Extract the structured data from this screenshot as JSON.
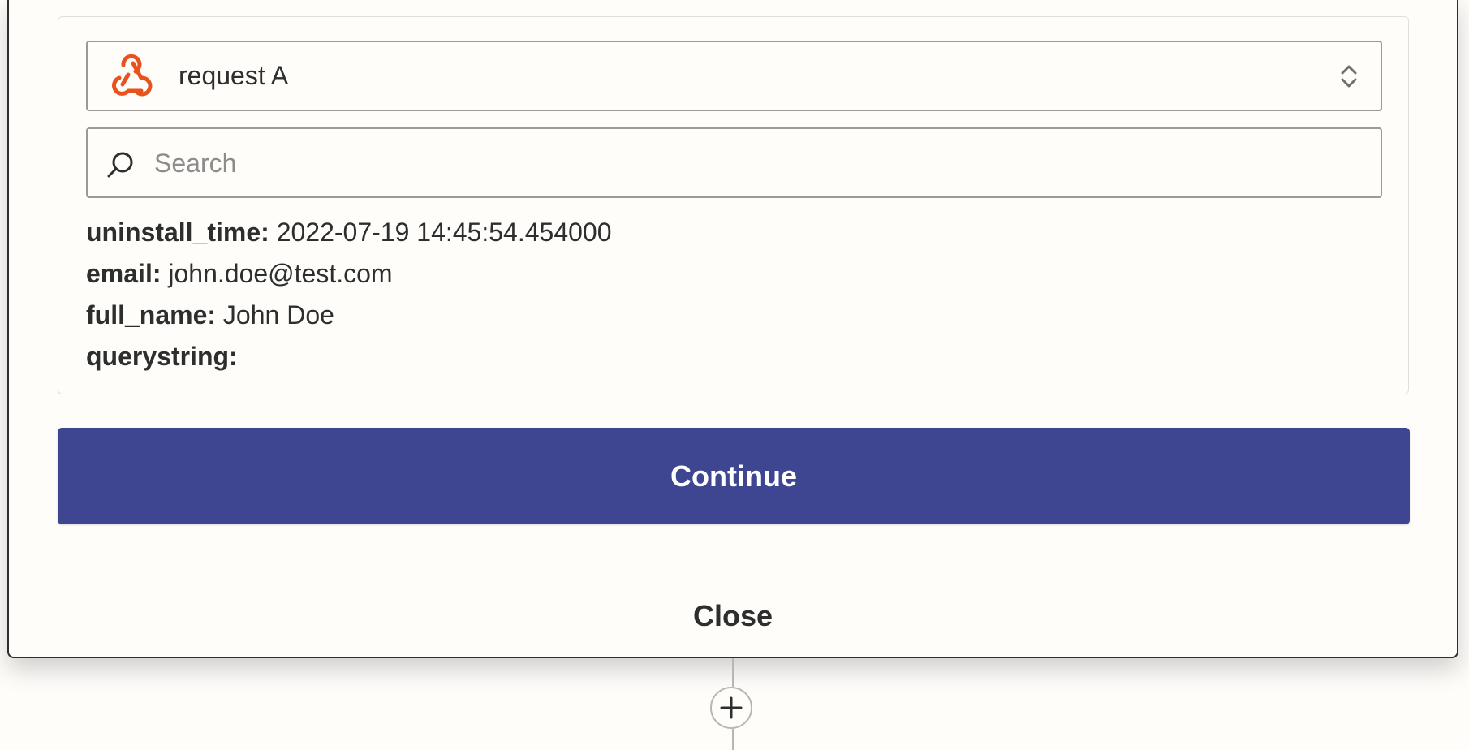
{
  "trigger_select": {
    "selected_label": "request A",
    "icon": "webhook-icon",
    "icon_color": "#e8521f"
  },
  "search": {
    "placeholder": "Search",
    "value": ""
  },
  "sample_fields": [
    {
      "key": "uninstall_time:",
      "value": "2022-07-19 14:45:54.454000"
    },
    {
      "key": "email:",
      "value": "john.doe@test.com"
    },
    {
      "key": "full_name:",
      "value": "John Doe"
    },
    {
      "key": "querystring:",
      "value": ""
    }
  ],
  "actions": {
    "continue_label": "Continue",
    "continue_color": "#3e4692",
    "close_label": "Close"
  },
  "flow": {
    "add_step_icon": "plus-icon"
  }
}
